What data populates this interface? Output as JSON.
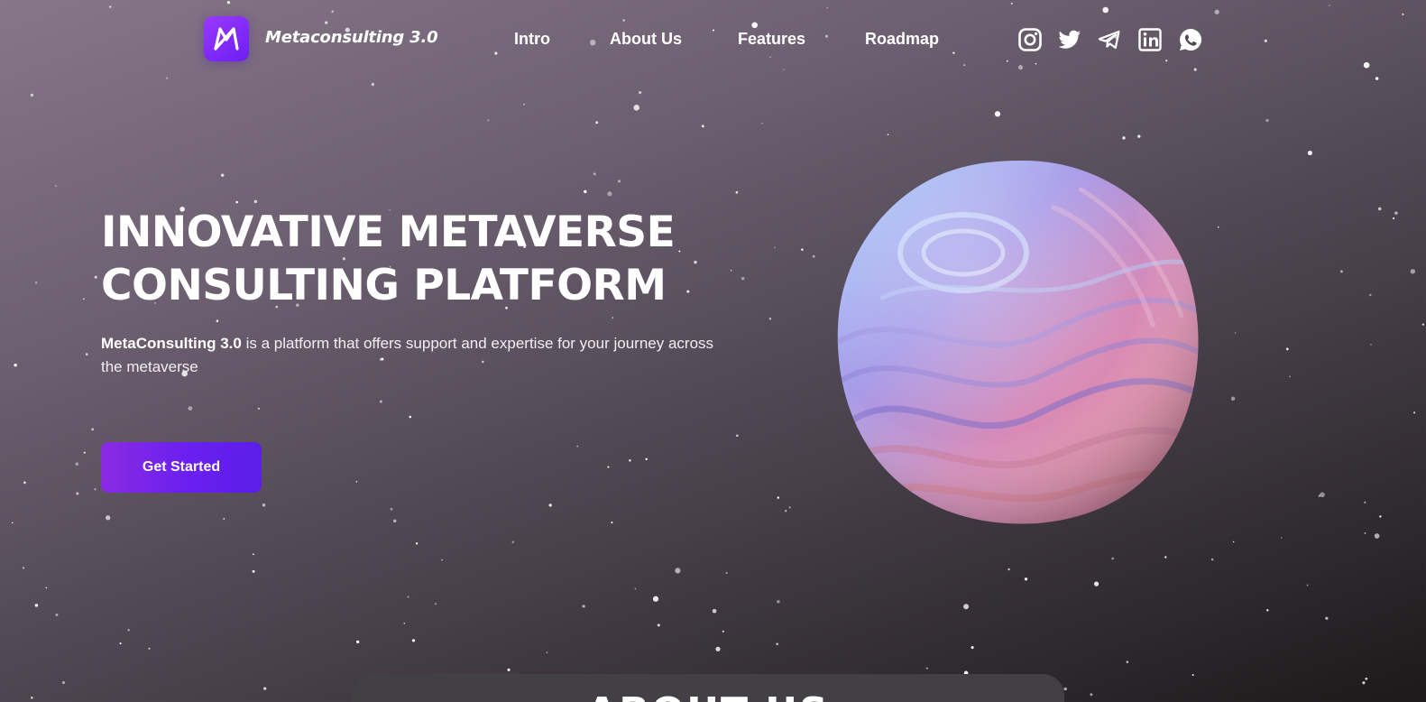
{
  "brand": {
    "name": "Metaconsulting 3.0",
    "logo_icon": "metaconsulting-m-logo",
    "logo_color_start": "#9a38ff",
    "logo_color_end": "#6c1ff2"
  },
  "nav": {
    "items": [
      {
        "label": "Intro"
      },
      {
        "label": "About Us"
      },
      {
        "label": "Features"
      },
      {
        "label": "Roadmap"
      }
    ]
  },
  "socials": [
    {
      "icon": "instagram-icon"
    },
    {
      "icon": "twitter-icon"
    },
    {
      "icon": "telegram-icon"
    },
    {
      "icon": "linkedin-icon"
    },
    {
      "icon": "whatsapp-icon"
    }
  ],
  "hero": {
    "title_line1": "INNOVATIVE METAVERSE",
    "title_line2": "CONSULTING PLATFORM",
    "description_strong": "MetaConsulting 3.0",
    "description_rest": " is a platform that offers support and expertise for your journey across the metaverse",
    "cta_label": "Get Started",
    "cta_color": "#7a22ee",
    "image": "pink-blue-wavy-sphere"
  },
  "about_section": {
    "title": "ABOUT US"
  }
}
